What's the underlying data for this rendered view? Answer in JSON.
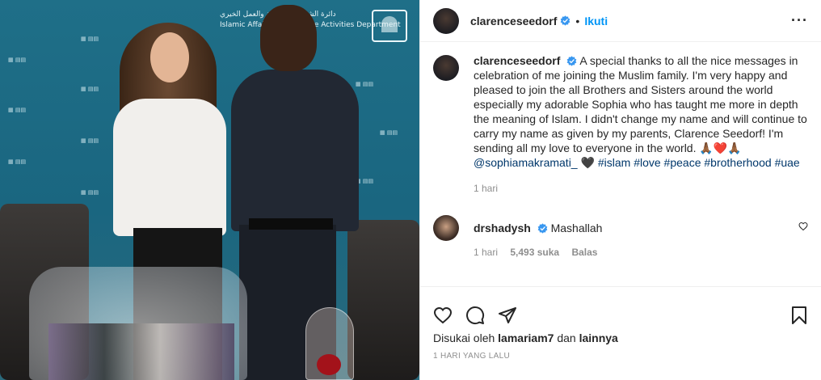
{
  "photo": {
    "alt": "",
    "banner_line1": "دائرة الشؤون الإسلامية والعمل الخيري",
    "banner_line2": "Islamic Affairs & Charitable Activities Department"
  },
  "header": {
    "username": "clarenceseedorf",
    "dot": "•",
    "follow_label": "Ikuti",
    "more_label": "···"
  },
  "caption": {
    "username": "clarenceseedorf",
    "text": "A special thanks to all the nice messages in celebration of me joining the Muslim family. I'm very happy and pleased to join the all Brothers and Sisters around the world especially my adorable Sophia who has taught me more in depth the meaning of Islam. I didn't change my name and will continue to carry my name as given by my parents, Clarence Seedorf! I'm sending all my love to everyone in the world. 🙏🏾❤️🙏🏾",
    "mention": "@sophiamakramati_",
    "heart": "🖤",
    "tags": [
      "#islam",
      "#love",
      "#peace",
      "#brotherhood",
      "#uae"
    ],
    "time": "1 hari"
  },
  "comment": {
    "username": "drshadysh",
    "text": "Mashallah",
    "time": "1 hari",
    "likes": "5,493 suka",
    "reply_label": "Balas"
  },
  "footer": {
    "liked_by_prefix": "Disukai oleh",
    "liked_by_user": "lamariam7",
    "liked_by_middle": "dan",
    "liked_by_others": "lainnya",
    "date": "1 HARI YANG LALU"
  },
  "colors": {
    "accent": "#0095f6",
    "link": "#00376b",
    "muted": "#8e8e8e",
    "verified": "#3897f0"
  },
  "icons": {
    "verified": "verified-badge-icon",
    "like": "heart-icon",
    "comment": "comment-bubble-icon",
    "share": "paper-plane-icon",
    "save": "bookmark-icon",
    "more": "ellipsis-icon"
  }
}
